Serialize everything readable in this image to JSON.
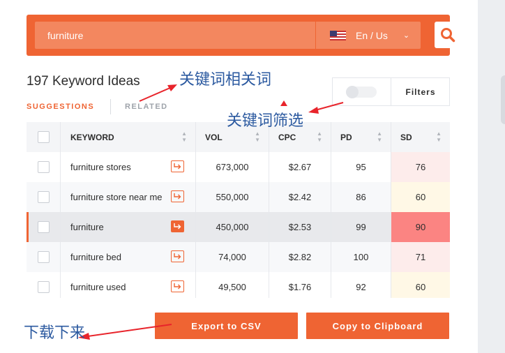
{
  "search": {
    "query": "furniture",
    "locale": "En / Us"
  },
  "icons": {
    "search": "search-icon",
    "flag": "us-flag-icon",
    "chevron": "chevron-down-icon",
    "open": "open-keyword-icon",
    "sort": "sort-icon"
  },
  "results": {
    "title": "197 Keyword Ideas",
    "tabs": [
      {
        "label": "SUGGESTIONS",
        "active": true
      },
      {
        "label": "RELATED",
        "active": false
      }
    ],
    "filters_label": "Filters"
  },
  "table": {
    "headers": {
      "keyword": "KEYWORD",
      "vol": "VOL",
      "cpc": "CPC",
      "pd": "PD",
      "sd": "SD"
    },
    "rows": [
      {
        "keyword": "furniture stores",
        "vol": "673,000",
        "cpc": "$2.67",
        "pd": "95",
        "sd": "76",
        "sd_color": "#fdeceb",
        "highlighted": false
      },
      {
        "keyword": "furniture store near me",
        "vol": "550,000",
        "cpc": "$2.42",
        "pd": "86",
        "sd": "60",
        "sd_color": "#fff8e6",
        "highlighted": false
      },
      {
        "keyword": "furniture",
        "vol": "450,000",
        "cpc": "$2.53",
        "pd": "99",
        "sd": "90",
        "sd_color": "#fb8482",
        "highlighted": true
      },
      {
        "keyword": "furniture bed",
        "vol": "74,000",
        "cpc": "$2.82",
        "pd": "100",
        "sd": "71",
        "sd_color": "#fdeceb",
        "highlighted": false
      },
      {
        "keyword": "furniture used",
        "vol": "49,500",
        "cpc": "$1.76",
        "pd": "92",
        "sd": "60",
        "sd_color": "#fff8e6",
        "highlighted": false
      }
    ]
  },
  "actions": {
    "export_csv": "Export to CSV",
    "copy_clipboard": "Copy to Clipboard"
  },
  "annotations": {
    "related_note": "关键词相关词",
    "filter_note": "关键词筛选",
    "download_note": "下载下来"
  },
  "colors": {
    "accent": "#ef6433",
    "annotation": "#2c5aa0",
    "arrow": "#e8242b"
  }
}
